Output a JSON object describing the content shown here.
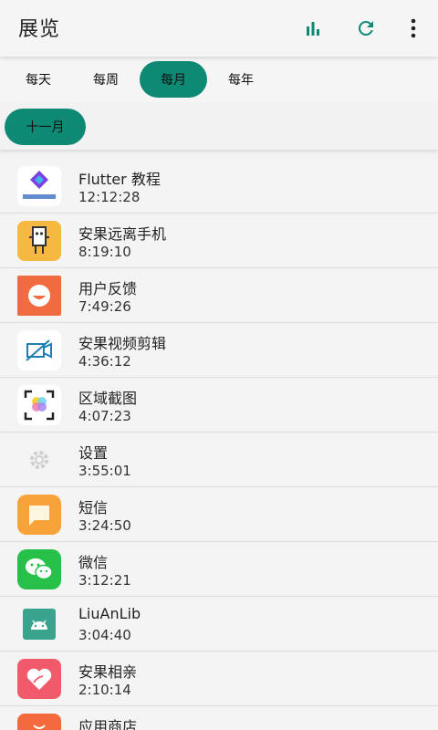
{
  "appbar": {
    "title": "展览",
    "actions": [
      {
        "icon": "bar-chart-icon"
      },
      {
        "icon": "refresh-icon"
      },
      {
        "icon": "more-vert-icon"
      }
    ]
  },
  "colors": {
    "accent": "#0e8a74",
    "background": "#f2f2f2",
    "appbar": "#f5f5f5"
  },
  "tabs": [
    {
      "label": "每天",
      "selected": false
    },
    {
      "label": "每周",
      "selected": false
    },
    {
      "label": "每月",
      "selected": true
    },
    {
      "label": "每年",
      "selected": false
    }
  ],
  "month_chip": "十一月",
  "apps": [
    {
      "name": "Flutter 教程",
      "time": "12:12:28",
      "icon": "flutter-icon"
    },
    {
      "name": "安果远离手机",
      "time": "8:19:10",
      "icon": "robot-icon"
    },
    {
      "name": "用户反馈",
      "time": "7:49:26",
      "icon": "smile-icon"
    },
    {
      "name": "安果视频剪辑",
      "time": "4:36:12",
      "icon": "video-off-icon"
    },
    {
      "name": "区域截图",
      "time": "4:07:23",
      "icon": "screenshot-icon"
    },
    {
      "name": "设置",
      "time": "3:55:01",
      "icon": "settings-icon"
    },
    {
      "name": "短信",
      "time": "3:24:50",
      "icon": "message-icon"
    },
    {
      "name": "微信",
      "time": "3:12:21",
      "icon": "wechat-icon"
    },
    {
      "name": "LiuAnLib",
      "time": "3:04:40",
      "icon": "android-icon"
    },
    {
      "name": "安果相亲",
      "time": "2:10:14",
      "icon": "heart-icon"
    },
    {
      "name": "应用商店",
      "time": "",
      "icon": "store-icon"
    }
  ]
}
